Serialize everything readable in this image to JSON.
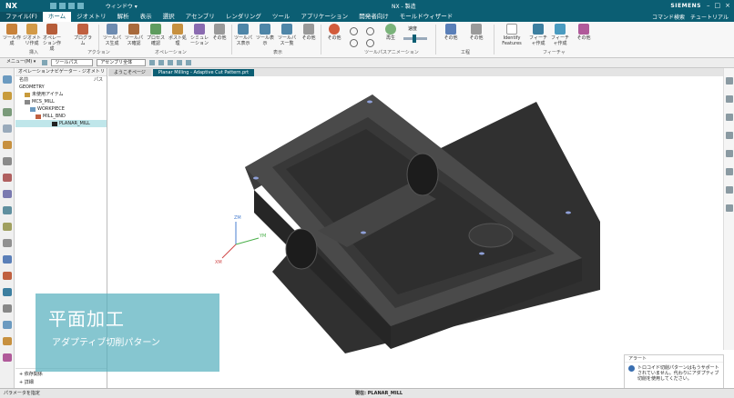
{
  "app": {
    "logo": "NX",
    "window_menu": "ウィンドウ ▾",
    "document": "NX - 製造",
    "brand": "SIEMENS"
  },
  "tabs": [
    "ファイル(F)",
    "ホーム",
    "ジオメトリ",
    "解析",
    "表示",
    "選択",
    "アセンブリ",
    "レンダリング",
    "ツール",
    "アプリケーション",
    "開発者向け",
    "モールドウィザード"
  ],
  "tabs_right": {
    "search": "コマンド検索",
    "tutorial": "チュートリアル"
  },
  "ribbon": {
    "buttons": [
      "ツール作成",
      "ジオメトリ作成",
      "オペレーション作成",
      "プログラム",
      "ツールパス生成",
      "ツールパス確認",
      "プロセス確認",
      "その他",
      "ツールパス表示",
      "ツール表示",
      "ツールパス一覧",
      "その他",
      "その他",
      "再生",
      "速度",
      "ポスト処理",
      "シミュレーション",
      "Identify Features",
      "フィーチャ作成",
      "その他"
    ],
    "groups": [
      "挿入",
      "アクション",
      "オペレーション",
      "表示",
      "ツールパスアニメーション",
      "工程",
      "フィーチャ"
    ]
  },
  "toolbar2": {
    "menu": "メニュー(M) ▾",
    "filter": "ツールパス",
    "scope": "アセンブリ全体"
  },
  "navigator": {
    "title": "オペレーションナビゲーター - ジオメトリ",
    "col_name": "名前",
    "col_path": "パス",
    "tree": [
      {
        "label": "GEOMETRY",
        "indent": 0
      },
      {
        "label": "未使用アイテム",
        "indent": 1
      },
      {
        "label": "MCS_MILL",
        "indent": 1
      },
      {
        "label": "WORKPIECE",
        "indent": 2
      },
      {
        "label": "MILL_BND",
        "indent": 3
      },
      {
        "label": "PLANAR_MILL",
        "indent": 4
      }
    ],
    "footer": [
      "依存関係",
      "詳細"
    ]
  },
  "doc_tabs": [
    "ようこそページ",
    "Planar Milling - Adaptive Cut Pattern.prt"
  ],
  "caption": {
    "title": "平面加工",
    "subtitle": "アダプティブ切削パターン"
  },
  "alert": {
    "header": "アラート",
    "message": "トロコイド切削パターンはもうサポートされていません。代わりにアダプティブ切削を使用してください。"
  },
  "status": {
    "left": "パラメータを指定",
    "center": "現在: PLANAR_MILL"
  },
  "axis_labels": {
    "x": "XM",
    "y": "YM",
    "z": "ZM"
  },
  "colors": {
    "titlebar": "#0b5e73",
    "caption_bg": "#58b0be",
    "part_top": "#4a4a4a",
    "part_side": "#2f2f2f"
  }
}
